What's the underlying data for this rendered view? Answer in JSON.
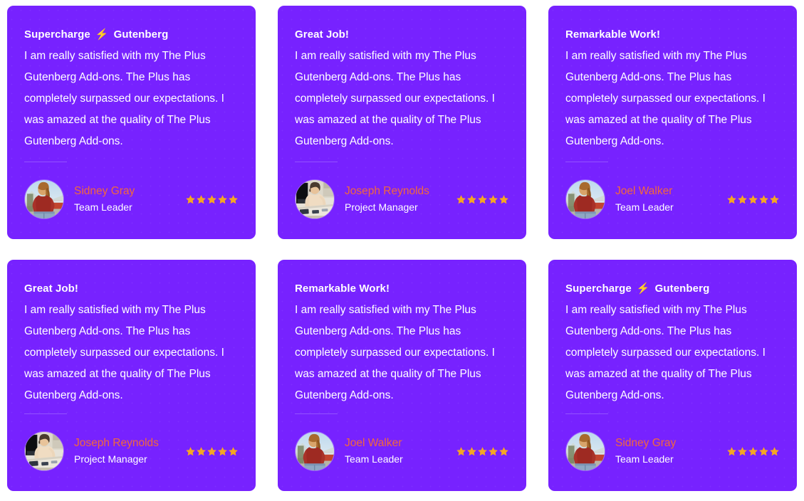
{
  "theme": {
    "card_bg": "#7722ff",
    "page_bg": "#ffffff",
    "title_color": "#ffffff",
    "body_color": "#ffffff",
    "name_color": "#f2683c",
    "role_color": "#ffffff",
    "star_color": "#f5a623",
    "bolt_color": "#f97316"
  },
  "icons": {
    "bolt": "⚡",
    "bolt_name": "lightning-bolt-icon",
    "star_name": "star-icon"
  },
  "shared": {
    "body_text": "I am really satisfied with my The Plus Gutenberg Add-ons. The Plus has completely surpassed our expectations. I was amazed at the quality of The Plus Gutenberg Add-ons."
  },
  "cards": [
    {
      "title_prefix": "Supercharge",
      "title_suffix": "Gutenberg",
      "has_bolt": true,
      "body": "I am really satisfied with my The Plus Gutenberg Add-ons. The Plus has completely surpassed our expectations. I was amazed at the quality of The Plus Gutenberg Add-ons.",
      "author_name": "Sidney Gray",
      "author_role": "Team Leader",
      "avatar": "woman-red-top",
      "rating": 5
    },
    {
      "title_prefix": "Great Job!",
      "title_suffix": "",
      "has_bolt": false,
      "body": "I am really satisfied with my The Plus Gutenberg Add-ons. The Plus has completely surpassed our expectations. I was amazed at the quality of The Plus Gutenberg Add-ons.",
      "author_name": "Joseph Reynolds",
      "author_role": "Project Manager",
      "avatar": "person-at-desk",
      "rating": 5
    },
    {
      "title_prefix": "Remarkable Work!",
      "title_suffix": "",
      "has_bolt": false,
      "body": "I am really satisfied with my The Plus Gutenberg Add-ons. The Plus has completely surpassed our expectations. I was amazed at the quality of The Plus Gutenberg Add-ons.",
      "author_name": "Joel Walker",
      "author_role": "Team Leader",
      "avatar": "woman-red-top",
      "rating": 5
    },
    {
      "title_prefix": "Great Job!",
      "title_suffix": "",
      "has_bolt": false,
      "body": "I am really satisfied with my The Plus Gutenberg Add-ons. The Plus has completely surpassed our expectations. I was amazed at the quality of The Plus Gutenberg Add-ons.",
      "author_name": "Joseph Reynolds",
      "author_role": "Project Manager",
      "avatar": "person-at-desk",
      "rating": 5
    },
    {
      "title_prefix": "Remarkable Work!",
      "title_suffix": "",
      "has_bolt": false,
      "body": "I am really satisfied with my The Plus Gutenberg Add-ons. The Plus has completely surpassed our expectations. I was amazed at the quality of The Plus Gutenberg Add-ons.",
      "author_name": "Joel Walker",
      "author_role": "Team Leader",
      "avatar": "woman-red-top",
      "rating": 5
    },
    {
      "title_prefix": "Supercharge",
      "title_suffix": "Gutenberg",
      "has_bolt": true,
      "body": "I am really satisfied with my The Plus Gutenberg Add-ons. The Plus has completely surpassed our expectations. I was amazed at the quality of The Plus Gutenberg Add-ons.",
      "author_name": "Sidney Gray",
      "author_role": "Team Leader",
      "avatar": "woman-red-top",
      "rating": 5
    }
  ]
}
